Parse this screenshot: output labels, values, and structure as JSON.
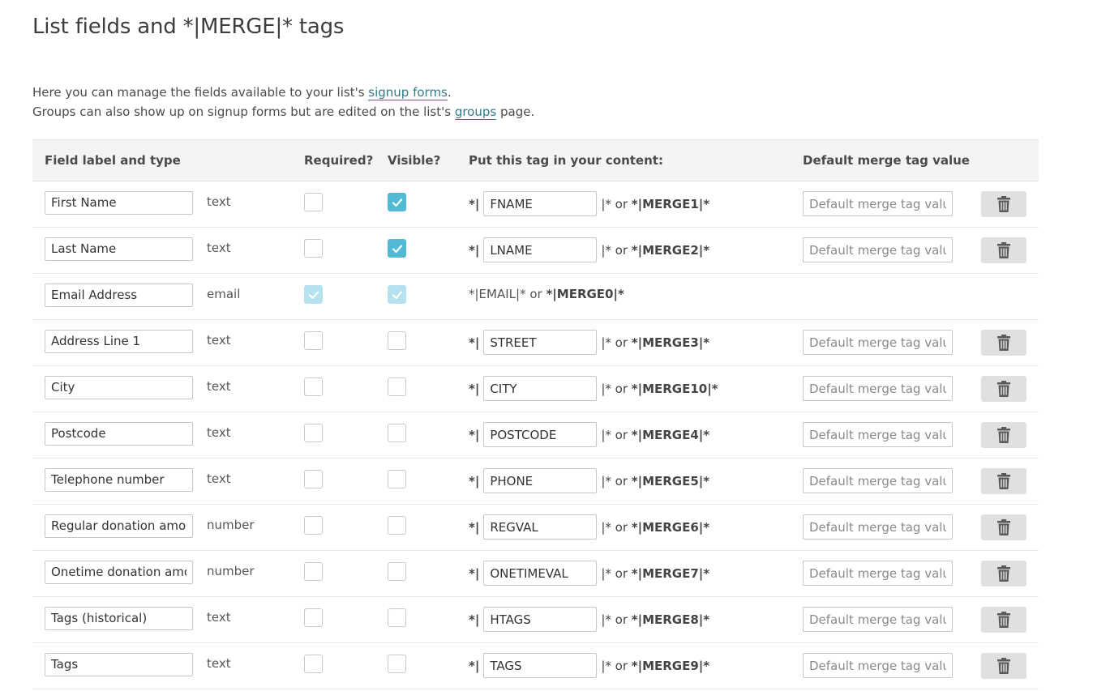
{
  "page": {
    "title": "List fields and *|MERGE|* tags",
    "intro": {
      "line1_before": "Here you can manage the fields available to your list's ",
      "line1_link": "signup forms",
      "line1_after": ".",
      "line2_before": "Groups can also show up on signup forms but are edited on the list's ",
      "line2_link": "groups",
      "line2_after": " page."
    }
  },
  "table": {
    "headers": {
      "field": "Field label and type",
      "required": "Required?",
      "visible": "Visible?",
      "tag": "Put this tag in your content:",
      "default": "Default merge tag value"
    },
    "default_placeholder": "Default merge tag value",
    "tag_prefix": "*|",
    "tag_suffix": "|* or ",
    "rows": [
      {
        "label": "First Name",
        "type": "text",
        "required": false,
        "visible": true,
        "tag": "FNAME",
        "merge": "*|MERGE1|*",
        "editable": true
      },
      {
        "label": "Last Name",
        "type": "text",
        "required": false,
        "visible": true,
        "tag": "LNAME",
        "merge": "*|MERGE2|*",
        "editable": true
      },
      {
        "label": "Email Address",
        "type": "email",
        "required": true,
        "visible": true,
        "tag": "*|EMAIL|* or ",
        "merge": "*|MERGE0|*",
        "editable": false
      },
      {
        "label": "Address Line 1",
        "type": "text",
        "required": false,
        "visible": false,
        "tag": "STREET",
        "merge": "*|MERGE3|*",
        "editable": true
      },
      {
        "label": "City",
        "type": "text",
        "required": false,
        "visible": false,
        "tag": "CITY",
        "merge": "*|MERGE10|*",
        "editable": true
      },
      {
        "label": "Postcode",
        "type": "text",
        "required": false,
        "visible": false,
        "tag": "POSTCODE",
        "merge": "*|MERGE4|*",
        "editable": true
      },
      {
        "label": "Telephone number",
        "type": "text",
        "required": false,
        "visible": false,
        "tag": "PHONE",
        "merge": "*|MERGE5|*",
        "editable": true
      },
      {
        "label": "Regular donation amount",
        "type": "number",
        "required": false,
        "visible": false,
        "tag": "REGVAL",
        "merge": "*|MERGE6|*",
        "editable": true
      },
      {
        "label": "Onetime donation amount",
        "type": "number",
        "required": false,
        "visible": false,
        "tag": "ONETIMEVAL",
        "merge": "*|MERGE7|*",
        "editable": true
      },
      {
        "label": "Tags (historical)",
        "type": "text",
        "required": false,
        "visible": false,
        "tag": "HTAGS",
        "merge": "*|MERGE8|*",
        "editable": true
      },
      {
        "label": "Tags",
        "type": "text",
        "required": false,
        "visible": false,
        "tag": "TAGS",
        "merge": "*|MERGE9|*",
        "editable": true
      }
    ]
  },
  "colors": {
    "accent": "#52bad5",
    "accent_disabled": "#b5e2ee",
    "link": "#2f7b8c",
    "trash": "#5a5a5a"
  },
  "icons": {
    "check": "check-icon",
    "delete": "trash-icon"
  }
}
